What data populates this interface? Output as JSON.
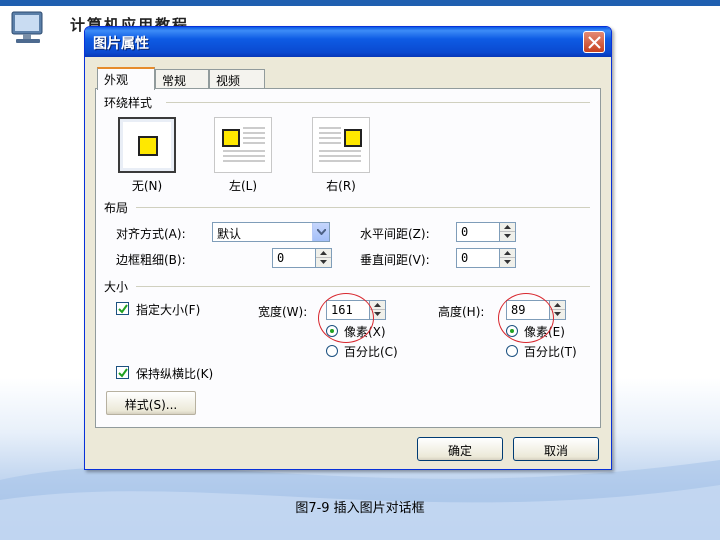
{
  "slide": {
    "header_text": "计算机应用教程",
    "caption": "图7-9 插入图片对话框"
  },
  "dialog": {
    "title": "图片属性",
    "tabs": [
      {
        "label": "外观"
      },
      {
        "label": "常规"
      },
      {
        "label": "视频"
      }
    ],
    "wrap": {
      "group_label": "环绕样式",
      "options": [
        {
          "label": "无(N)",
          "selected": true
        },
        {
          "label": "左(L)",
          "selected": false
        },
        {
          "label": "右(R)",
          "selected": false
        }
      ]
    },
    "layout": {
      "group_label": "布局",
      "align_label": "对齐方式(A):",
      "align_value": "默认",
      "border_label": "边框粗细(B):",
      "border_value": "0",
      "hspace_label": "水平间距(Z):",
      "hspace_value": "0",
      "vspace_label": "垂直间距(V):",
      "vspace_value": "0"
    },
    "size": {
      "group_label": "大小",
      "specify_label": "指定大小(F)",
      "specify_checked": true,
      "width_label": "宽度(W):",
      "width_value": "161",
      "width_pixels_label": "像素(X)",
      "width_percent_label": "百分比(C)",
      "height_label": "高度(H):",
      "height_value": "89",
      "height_pixels_label": "像素(E)",
      "height_percent_label": "百分比(T)",
      "keep_ratio_label": "保持纵横比(K)",
      "keep_ratio_checked": true
    },
    "style_button": "样式(S)...",
    "ok_button": "确定",
    "cancel_button": "取消"
  },
  "colors": {
    "titlebar": "#0a49d0",
    "annotation": "#d8282f",
    "slide_accent": "#1f5fb0"
  }
}
